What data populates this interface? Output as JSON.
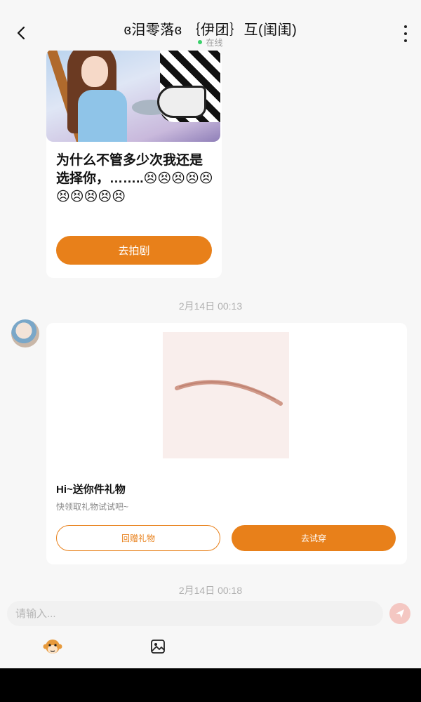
{
  "header": {
    "title": "ɞ泪零落ɞ ｛伊团｝互(闺闺)",
    "status": "在线",
    "back_icon": "chevron-left-icon",
    "more_icon": "more-vertical-icon"
  },
  "messages": {
    "card1": {
      "text": "为什么不管多少次我还是选择你，……..😣😣😣😣😣😣😣😣😣😣",
      "button": "去拍剧"
    },
    "timestamp1": "2月14日 00:13",
    "card2": {
      "title": "Hi~送你件礼物",
      "subtitle": "快领取礼物试试吧~",
      "button_left": "回赠礼物",
      "button_right": "去试穿"
    },
    "timestamp2": "2月14日 00:18"
  },
  "input": {
    "placeholder": "请输入...",
    "send_icon": "send-icon"
  },
  "toolbar": {
    "left_icon": "monkey-emoji-icon",
    "right_icon": "image-icon"
  },
  "colors": {
    "accent": "#e8801a",
    "online": "#3ad06a",
    "send_disabled": "#f4c7c2"
  }
}
